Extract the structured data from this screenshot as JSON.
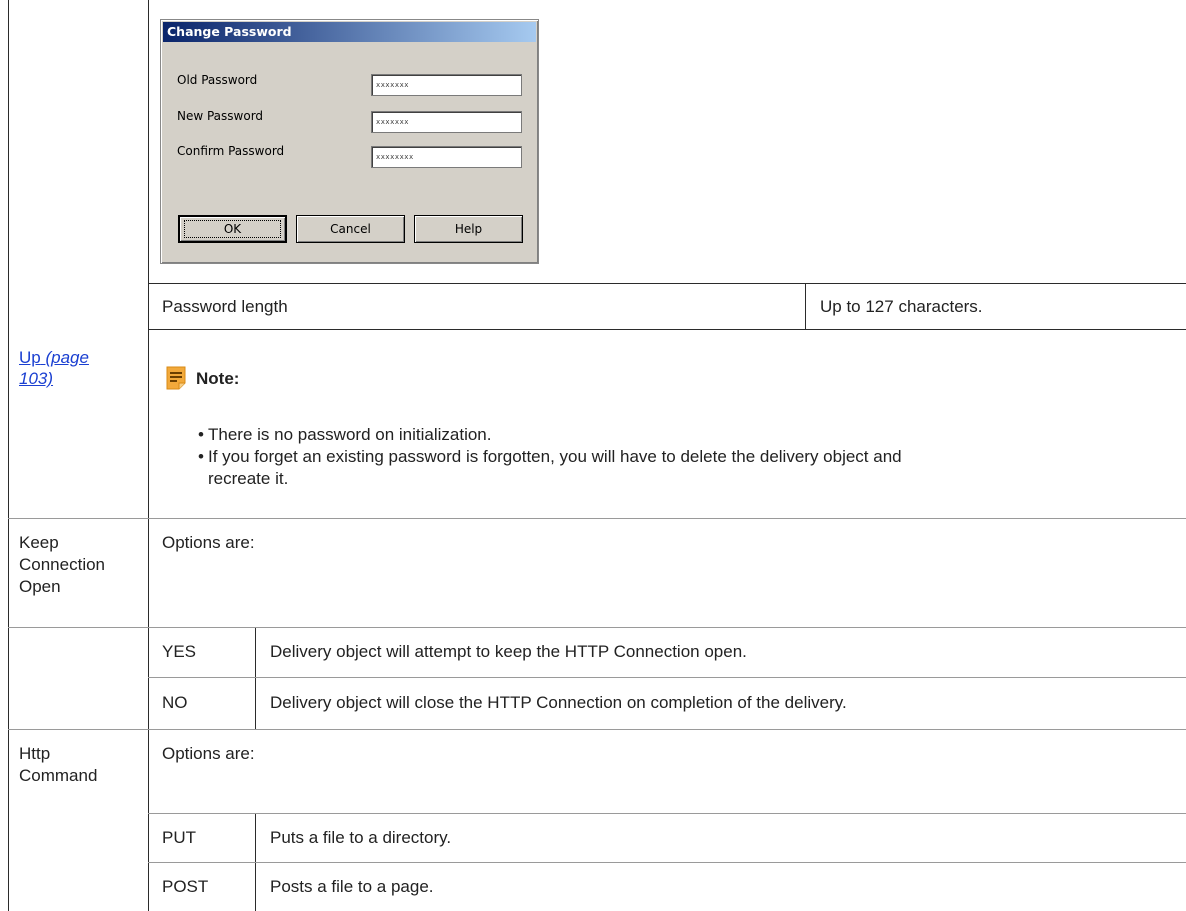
{
  "dialog": {
    "title": "Change Password",
    "old_password_label": "Old Password",
    "new_password_label": "New Password",
    "confirm_password_label": "Confirm Password",
    "old_password_value": "xxxxxxx",
    "new_password_value": "xxxxxxx",
    "confirm_password_value": "xxxxxxxx",
    "ok_label": "OK",
    "cancel_label": "Cancel",
    "help_label": "Help"
  },
  "password_length": {
    "label": "Password length",
    "value": "Up to 127 characters."
  },
  "up_link": {
    "text": "Up",
    "page_ref_line1": "(page",
    "page_ref_line2": "103)"
  },
  "note": {
    "title": "Note:",
    "bullets": [
      "There is no password on initialization.",
      "If you forget an existing password is forgotten, you will have to delete the delivery object and",
      "recreate it."
    ]
  },
  "keep_connection": {
    "label_line1": "Keep",
    "label_line2": "Connection",
    "label_line3": "Open",
    "intro": "Options are:",
    "options": [
      {
        "key": "YES",
        "desc": "Delivery object will attempt to keep the HTTP Connection open."
      },
      {
        "key": "NO",
        "desc": "Delivery object will close the HTTP Connection on completion of the delivery."
      }
    ]
  },
  "http_command": {
    "label_line1": "Http",
    "label_line2": "Command",
    "intro": "Options are:",
    "options": [
      {
        "key": "PUT",
        "desc": "Puts a file to a directory."
      },
      {
        "key": "POST",
        "desc": "Posts a file to a page."
      }
    ]
  },
  "colors": {
    "link": "#1a3fd1",
    "note_icon": "#f2a93b",
    "dialog_bg": "#d4d0c8",
    "title_bar": "#0a246a"
  }
}
